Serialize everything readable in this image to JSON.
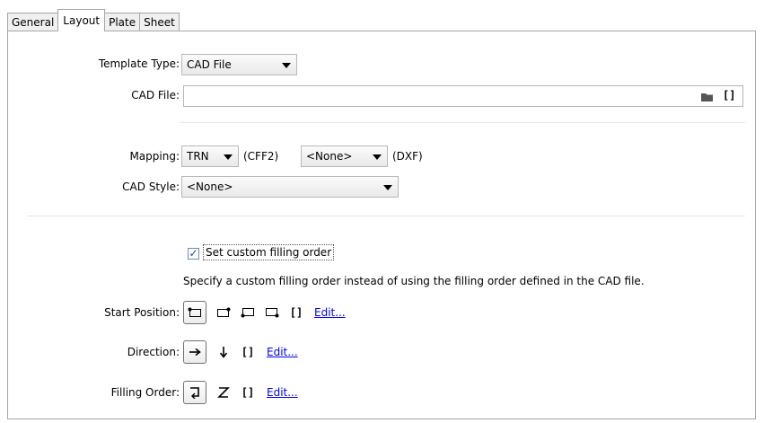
{
  "tabs": [
    {
      "label": "General",
      "active": false
    },
    {
      "label": "Layout",
      "active": true
    },
    {
      "label": "Plate",
      "active": false
    },
    {
      "label": "Sheet",
      "active": false
    }
  ],
  "template_type": {
    "label": "Template Type:",
    "value": "CAD File"
  },
  "cad_file": {
    "label": "CAD File:",
    "value": "",
    "browse_icon": "folder-icon",
    "extra_icon": "bracket-icon"
  },
  "mapping": {
    "label": "Mapping:",
    "cff2_value": "TRN",
    "cff2_suffix": "(CFF2)",
    "dxf_value": "<None>",
    "dxf_suffix": "(DXF)"
  },
  "cad_style": {
    "label": "CAD Style:",
    "value": "<None>"
  },
  "custom_filling": {
    "checkbox_label": "Set custom filling order",
    "checked": true,
    "description": "Specify a custom filling order instead of using the filling order defined in the CAD file."
  },
  "start_position": {
    "label": "Start Position:",
    "options": [
      "top-left-corner-icon",
      "top-right-corner-icon",
      "bottom-left-corner-icon",
      "bottom-right-corner-icon",
      "bracket-icon"
    ],
    "selected": "top-left-corner-icon",
    "edit_label": "Edit..."
  },
  "direction": {
    "label": "Direction:",
    "options": [
      "arrow-right-icon",
      "arrow-down-icon",
      "bracket-icon"
    ],
    "selected": "arrow-right-icon",
    "edit_label": "Edit..."
  },
  "filling_order": {
    "label": "Filling Order:",
    "options": [
      "snake-order-icon",
      "z-order-icon",
      "bracket-icon"
    ],
    "selected": "snake-order-icon",
    "edit_label": "Edit..."
  }
}
